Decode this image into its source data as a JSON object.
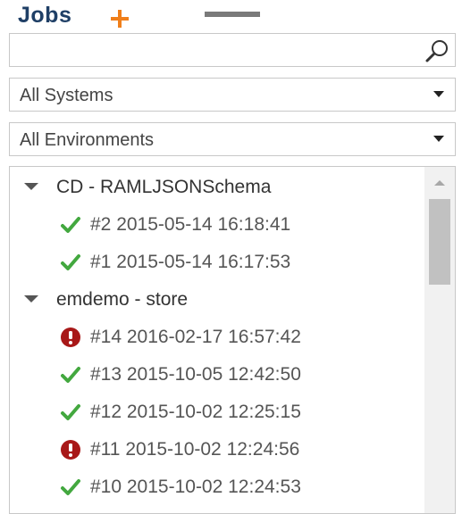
{
  "header": {
    "title": "Jobs"
  },
  "search": {
    "value": "",
    "placeholder": ""
  },
  "filters": {
    "system": {
      "selected": "All Systems"
    },
    "environment": {
      "selected": "All Environments"
    }
  },
  "colors": {
    "success": "#43a83f",
    "error": "#a81818",
    "title": "#1f3f66",
    "add": "#f07f1a"
  },
  "tree": [
    {
      "name": "CD - RAMLJSONSchema",
      "expanded": true,
      "jobs": [
        {
          "label": "#2 2015-05-14 16:18:41",
          "status": "success"
        },
        {
          "label": "#1 2015-05-14 16:17:53",
          "status": "success"
        }
      ]
    },
    {
      "name": "emdemo - store",
      "expanded": true,
      "jobs": [
        {
          "label": "#14 2016-02-17 16:57:42",
          "status": "error"
        },
        {
          "label": "#13 2015-10-05 12:42:50",
          "status": "success"
        },
        {
          "label": "#12 2015-10-02 12:25:15",
          "status": "success"
        },
        {
          "label": "#11 2015-10-02 12:24:56",
          "status": "error"
        },
        {
          "label": "#10 2015-10-02 12:24:53",
          "status": "success"
        }
      ]
    }
  ]
}
